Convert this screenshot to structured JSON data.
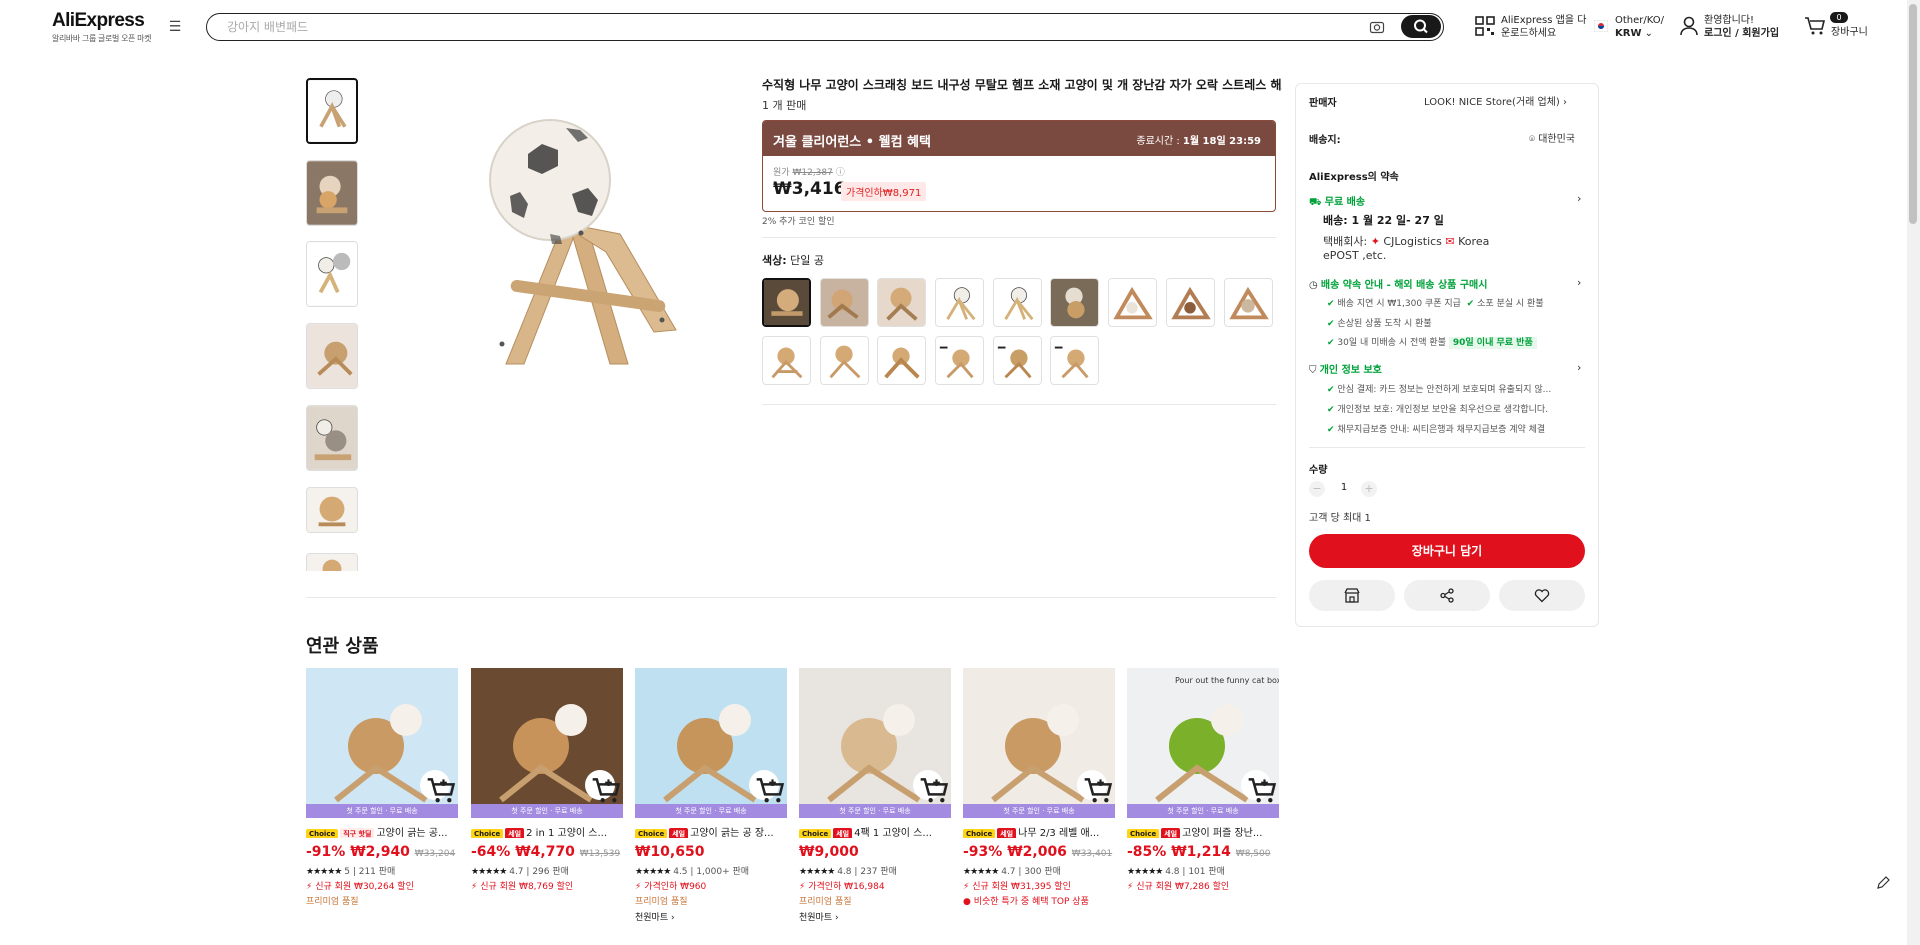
{
  "header": {
    "logo": "AliExpress",
    "logo_sub": "알리바바 그룹 글로벌 오픈 마켓",
    "search_placeholder": "강아지 배변패드",
    "app_line1": "AliExpress 앱을 다",
    "app_line2": "운로드하세요",
    "locale_line1": "Other/KO/",
    "locale_line2": "KRW",
    "welcome": "환영합니다!",
    "login": "로그인 / 회원가입",
    "cart_count": "0",
    "cart_label": "장바구니"
  },
  "product": {
    "title": "수직형 나무 고양이 스크래칭 보드 내구성 무탈모 헴프 소재 고양이 및 개 장난감 자가 오락 스트레스 해소",
    "sold": "1 개 판매",
    "promo_title": "겨울 클리어런스 • 웰컴 혜택",
    "promo_end_label": "종료시간 :",
    "promo_end_value": "1월 18일 23:59",
    "orig_label": "원가",
    "orig_price": "₩12,387",
    "price": "₩3,416",
    "discount": "가격인하₩8,971",
    "coin": "2% 추가 코인 할인",
    "color_label": "색상:",
    "color_value": "단일 공"
  },
  "panel": {
    "seller_label": "판매자",
    "seller_value": "LOOK! NICE Store(거래 업체)",
    "ship_to_label": "배송지:",
    "ship_to_value": "대한민국",
    "promise_title": "AliExpress의 약속",
    "free_ship": "무료 배송",
    "delivery": "배송: 1 월 22 일- 27 일",
    "carrier_label": "택배회사:",
    "carrier1": "CJLogistics",
    "carrier2": "Korea",
    "carrier3": "ePOST ,etc.",
    "guarantee_title": "배송 약속 안내 - 해외 배송 상품 구매시",
    "g1": "배송 지연 시 ₩1,300 쿠폰 지급",
    "g2": "소포 분실 시 환불",
    "g3": "손상된 상품 도착 시 환불",
    "g4": "30일 내 미배송 시 전액 환불",
    "g4_badge": "90일 이내 무료 반품",
    "privacy_title": "개인 정보 보호",
    "p1": "안심 결제: 카드 정보는 안전하게 보호되며 유출되지 않...",
    "p2": "개인정보 보호: 개인정보 보안을 최우선으로 생각합니다.",
    "p3": "채무지급보증 안내: 씨티은행과 채무지급보증 계약 체결",
    "qty_label": "수량",
    "qty_value": "1",
    "max_per": "고객 당 최대 1",
    "add_cart": "장바구니 담기"
  },
  "related": {
    "title": "연관 상품",
    "bar_text": "첫 주문 할인 · 무료 배송",
    "items": [
      {
        "tag1": "Choice",
        "tag2": "직구 핫딜",
        "title": "고양이 긁는 공...",
        "price": "-91% ₩2,940",
        "orig": "₩33,204",
        "rating": "5",
        "sold": "211 판매",
        "red": "신규 회원 ₩30,264 할인",
        "brown": "프리미엄 품질",
        "mart": ""
      },
      {
        "tag1": "Choice",
        "tag2": "세일",
        "title": "2 in 1 고양이 스...",
        "price": "-64% ₩4,770",
        "orig": "₩13,539",
        "rating": "4.7",
        "sold": "296 판매",
        "red": "신규 회원 ₩8,769 할인",
        "brown": "",
        "mart": ""
      },
      {
        "tag1": "Choice",
        "tag2": "세일",
        "title": "고양이 긁는 공 장...",
        "price": "₩10,650",
        "orig": "",
        "rating": "4.5",
        "sold": "1,000+ 판매",
        "red": "가격인하 ₩960",
        "brown": "프리미엄 품질",
        "mart": "천원마트 ›"
      },
      {
        "tag1": "Choice",
        "tag2": "세일",
        "title": "4팩 1 고양이 스...",
        "price": "₩9,000",
        "orig": "",
        "rating": "4.8",
        "sold": "237 판매",
        "red": "가격인하 ₩16,984",
        "brown": "프리미엄 품질",
        "mart": "천원마트 ›"
      },
      {
        "tag1": "Choice",
        "tag2": "세일",
        "title": "나무 2/3 레벨 애...",
        "price": "-93% ₩2,006",
        "orig": "₩33,401",
        "rating": "4.7",
        "sold": "300 판매",
        "red": "신규 회원 ₩31,395 할인",
        "brown": "",
        "mart": "",
        "extra": "비슷한 특가 중 혜택 TOP 상품"
      },
      {
        "tag1": "Choice",
        "tag2": "세일",
        "title": "고양이 퍼즐 장난...",
        "price": "-85% ₩1,214",
        "orig": "₩8,500",
        "rating": "4.8",
        "sold": "101 판매",
        "red": "신규 회원 ₩7,286 할인",
        "brown": "",
        "mart": "",
        "img_text": "Pour out the funny cat box"
      }
    ]
  },
  "colors": {
    "accent": "#e0101c",
    "promo": "#7a4a40",
    "green": "#00a23a",
    "bar": "#a28be0"
  }
}
